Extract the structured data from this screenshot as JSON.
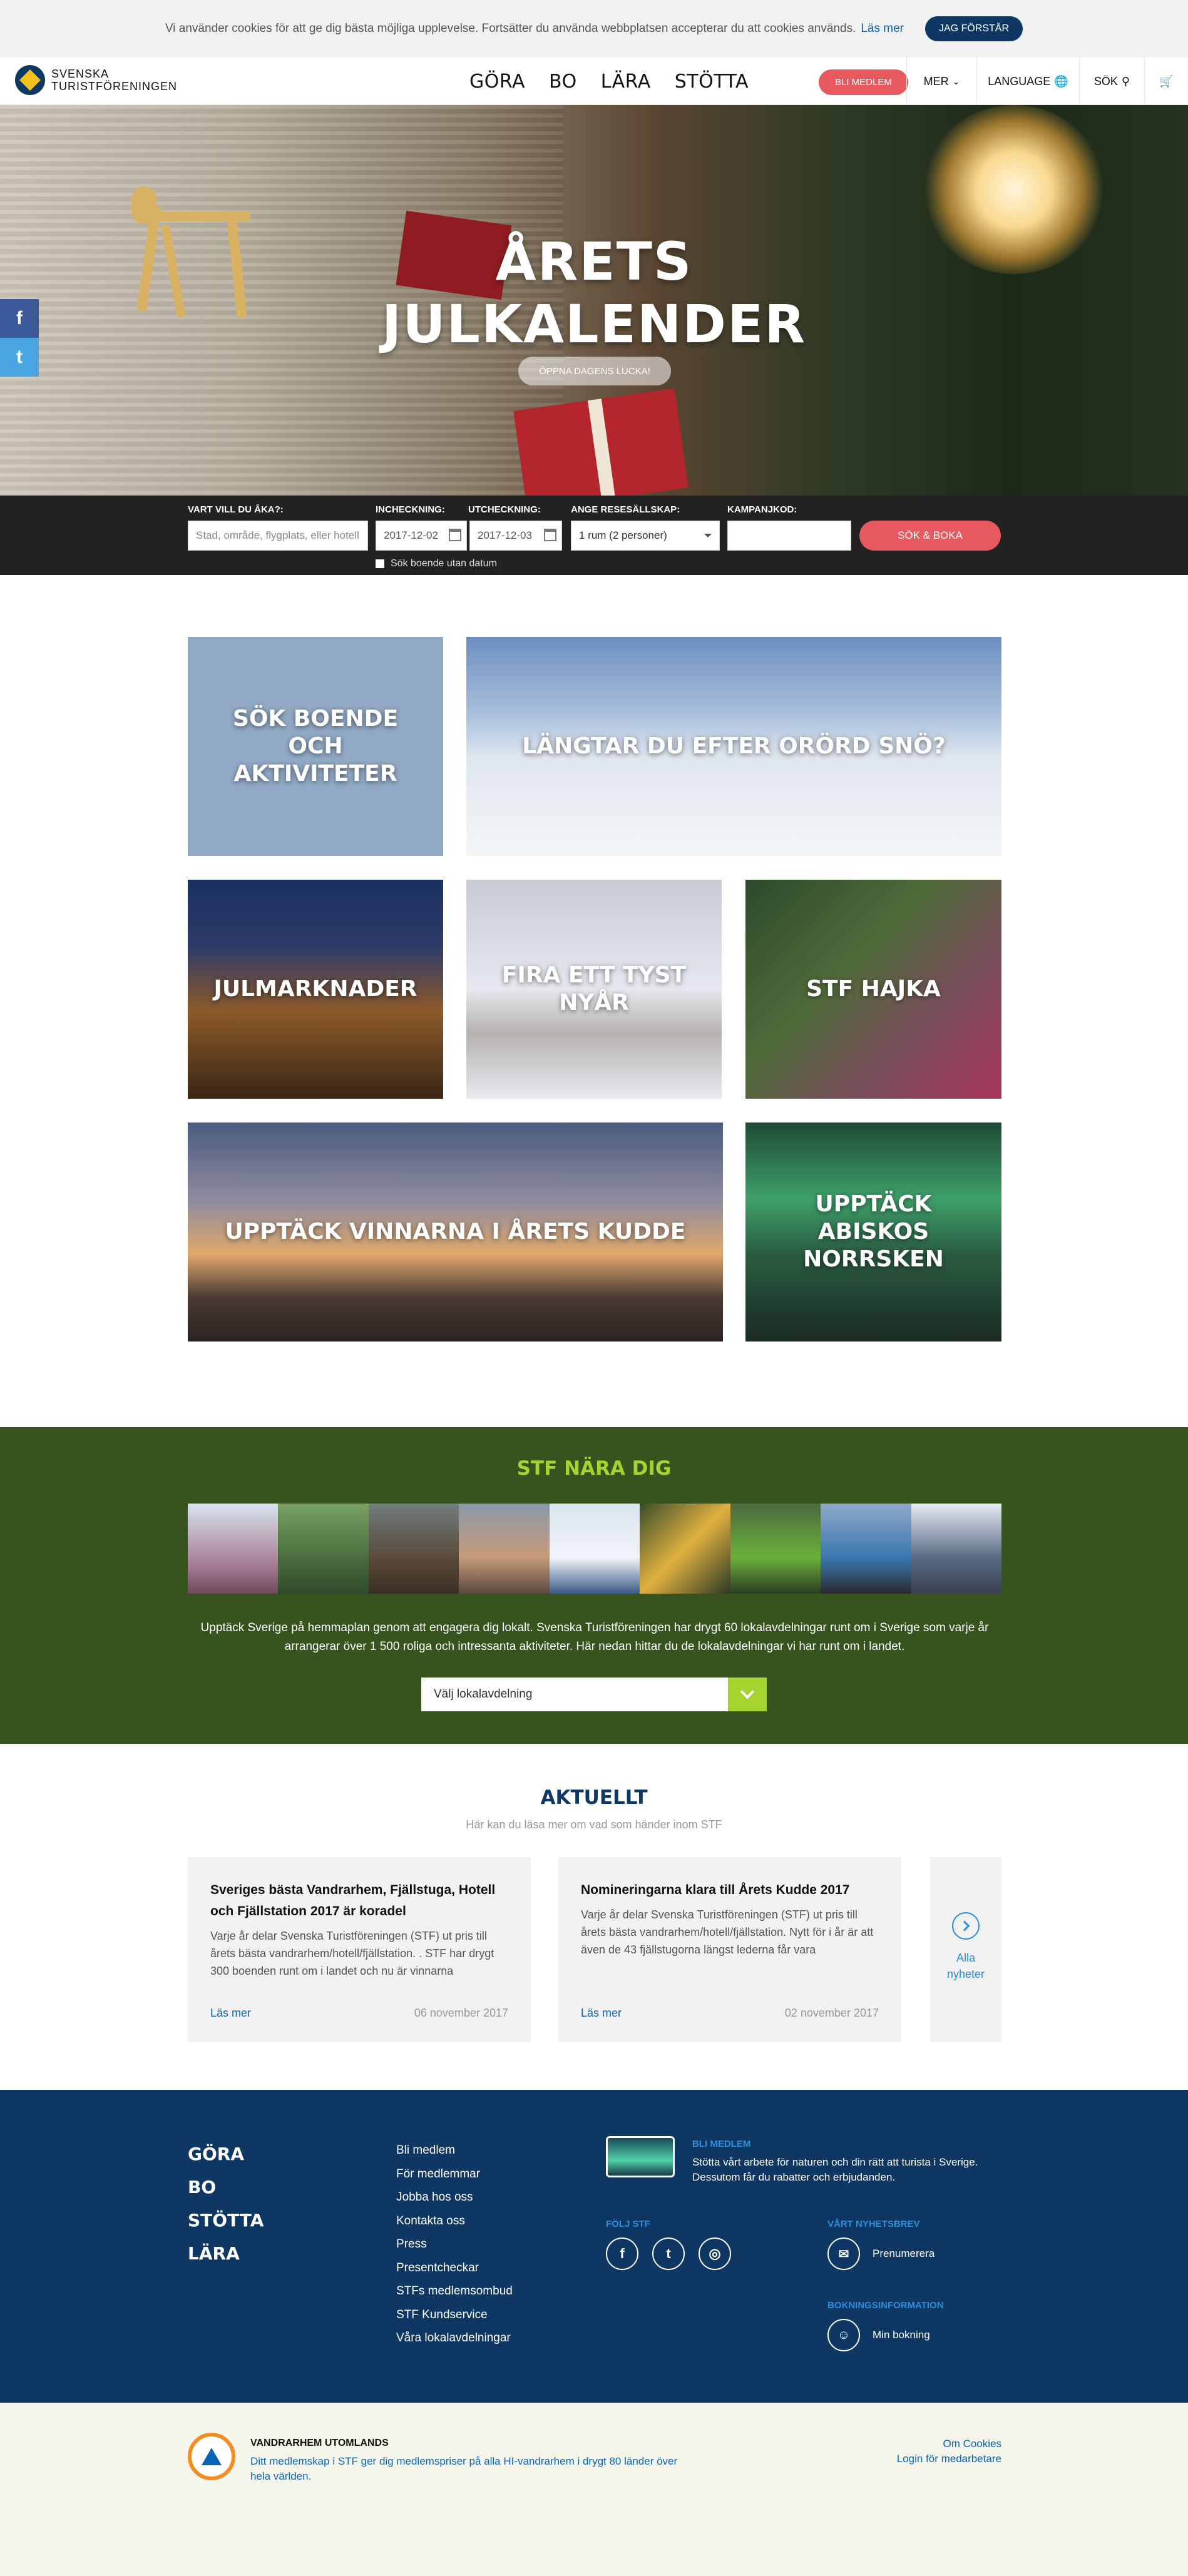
{
  "cookie": {
    "text": "Vi använder cookies för att ge dig bästa möjliga upplevelse. Fortsätter du använda webbplatsen accepterar du att cookies används.",
    "link": "Läs mer",
    "button": "JAG FÖRSTÅR"
  },
  "header": {
    "logo_line1": "SVENSKA",
    "logo_line2": "TURISTFÖRENINGEN",
    "nav": [
      "GÖRA",
      "BO",
      "LÄRA",
      "STÖTTA"
    ],
    "member_button": "BLI MEDLEM",
    "more": "MER",
    "more_icon": "chevron-down-icon",
    "language": "LANGUAGE",
    "language_icon": "globe-icon",
    "search": "SÖK",
    "search_icon": "search-icon",
    "cart_icon": "cart-icon"
  },
  "hero": {
    "title_line1": "ÅRETS",
    "title_line2": "JULKALENDER",
    "button": "ÖPPNA DAGENS LUCKA!"
  },
  "social_side": {
    "facebook": "f",
    "twitter": "t"
  },
  "booking": {
    "where_label": "VART VILL DU ÅKA?:",
    "where_placeholder": "Stad, område, flygplats, eller hotell",
    "checkin_label": "INCHECKNING:",
    "checkin_value": "2017-12-02",
    "checkout_label": "UTCHECKNING:",
    "checkout_value": "2017-12-03",
    "party_label": "ANGE RESESÄLLSKAP:",
    "party_value": "1 rum (2 personer)",
    "code_label": "KAMPANJKOD:",
    "code_value": "",
    "submit": "SÖK & BOKA",
    "no_date": "Sök boende utan datum"
  },
  "tiles": [
    "SÖK BOENDE OCH AKTIVITETER",
    "LÄNGTAR DU EFTER ORÖRD SNÖ?",
    "JULMARKNADER",
    "FIRA ETT TYST NYÅR",
    "STF HAJKA",
    "UPPTÄCK VINNARNA I ÅRETS KUDDE",
    "UPPTÄCK ABISKOS NORRSKEN"
  ],
  "nara": {
    "title": "STF NÄRA DIG",
    "text": "Upptäck Sverige på hemmaplan genom att engagera dig lokalt. Svenska Turistföreningen har drygt 60 lokalavdelningar runt om i Sverige som varje år arrangerar över 1 500 roliga och intressanta aktiviteter. Här nedan hittar du de lokalavdelningar vi har runt om i landet.",
    "select": "Välj lokalavdelning"
  },
  "aktuellt": {
    "title": "AKTUELLT",
    "subtitle": "Här kan du läsa mer om vad som händer inom STF",
    "cards": [
      {
        "title": "Sveriges bästa Vandrarhem, Fjällstuga, Hotell och Fjällstation 2017 är koradel",
        "text": "Varje år delar Svenska Turistföreningen (STF) ut pris till årets bästa vandrarhem/hotell/fjällstation. . STF har drygt 300 boenden runt om i landet och nu är vinnarna",
        "more": "Läs mer",
        "date": "06 november 2017"
      },
      {
        "title": "Nomineringarna klara till Årets Kudde 2017",
        "text": "Varje år delar Svenska Turistföreningen (STF) ut pris till årets bästa vandrarhem/hotell/fjällstation. Nytt för i år är att även de 43 fjällstugorna längst lederna får vara",
        "more": "Läs mer",
        "date": "02 november 2017"
      }
    ],
    "all_news_line1": "Alla",
    "all_news_line2": "nyheter"
  },
  "footer": {
    "main_links": [
      "GÖRA",
      "BO",
      "STÖTTA",
      "LÄRA"
    ],
    "links": [
      "Bli medlem",
      "För medlemmar",
      "Jobba hos oss",
      "Kontakta oss",
      "Press",
      "Presentcheckar",
      "STFs medlemsombud",
      "STF Kundservice",
      "Våra lokalavdelningar"
    ],
    "member_heading": "BLI MEDLEM",
    "member_text": "Stötta vårt arbete för naturen och din rätt att turista i Sverige. Dessutom får du rabatter och erbjudanden.",
    "follow_heading": "FÖLJ STF",
    "newsletter_heading": "VÅRT NYHETSBREV",
    "newsletter_link": "Prenumerera",
    "booking_heading": "BOKNINGSINFORMATION",
    "booking_link": "Min bokning"
  },
  "bottom": {
    "hi_title": "VANDRARHEM UTOMLANDS",
    "hi_text": "Ditt medlemskap i STF ger dig medlemspriser på alla HI-vandrarhem i drygt 80 länder över hela världen.",
    "cookies": "Om Cookies",
    "staff_login": "Login för medarbetare"
  }
}
